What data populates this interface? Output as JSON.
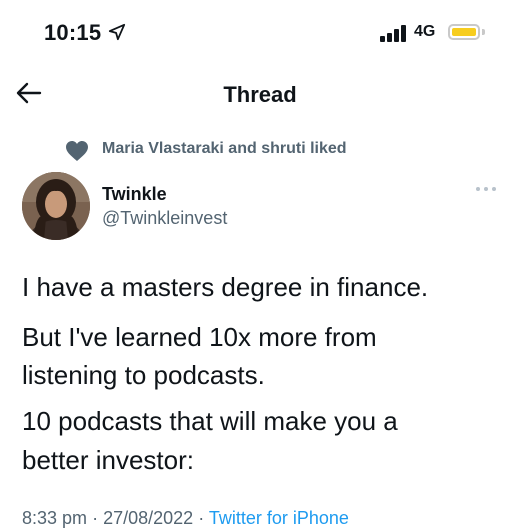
{
  "status_bar": {
    "time": "10:15",
    "network": "4G",
    "icons": [
      "location-arrow-icon",
      "signal-icon",
      "battery-icon"
    ],
    "battery_color": "#f7cd1f"
  },
  "nav": {
    "title": "Thread",
    "back_icon": "back-arrow-icon"
  },
  "social_context": {
    "text": "Maria Vlastaraki and shruti liked",
    "icon": "heart-icon"
  },
  "author": {
    "name": "Twinkle",
    "handle": "@Twinkleinvest",
    "more_icon": "more-icon"
  },
  "tweet": {
    "line1": "I have a masters degree in finance.",
    "line2": "But I've learned 10x more from",
    "line3": "listening to podcasts.",
    "line4": "10 podcasts that will make you a",
    "line5": "better investor:"
  },
  "meta": {
    "time": "8:33 pm",
    "date": "27/08/2022",
    "source": "Twitter for iPhone"
  },
  "colors": {
    "text": "#0f1419",
    "secondary": "#536471",
    "link": "#1d9bf0"
  }
}
